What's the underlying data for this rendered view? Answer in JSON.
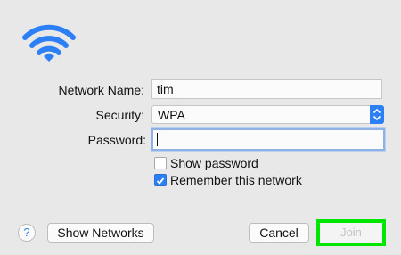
{
  "icons": {
    "wifi": "wifi-icon",
    "select_arrows": "chevron-up-down-icon",
    "help": "question-mark"
  },
  "colors": {
    "accent": "#2d7ff5",
    "highlight": "#00e600"
  },
  "form": {
    "network_name_label": "Network Name:",
    "network_name_value": "tim",
    "security_label": "Security:",
    "security_value": "WPA",
    "password_label": "Password:",
    "password_value": "",
    "show_password_label": "Show password",
    "show_password_checked": false,
    "remember_label": "Remember this network",
    "remember_checked": true
  },
  "buttons": {
    "help": "?",
    "show_networks": "Show Networks",
    "cancel": "Cancel",
    "join": "Join",
    "join_enabled": false
  }
}
